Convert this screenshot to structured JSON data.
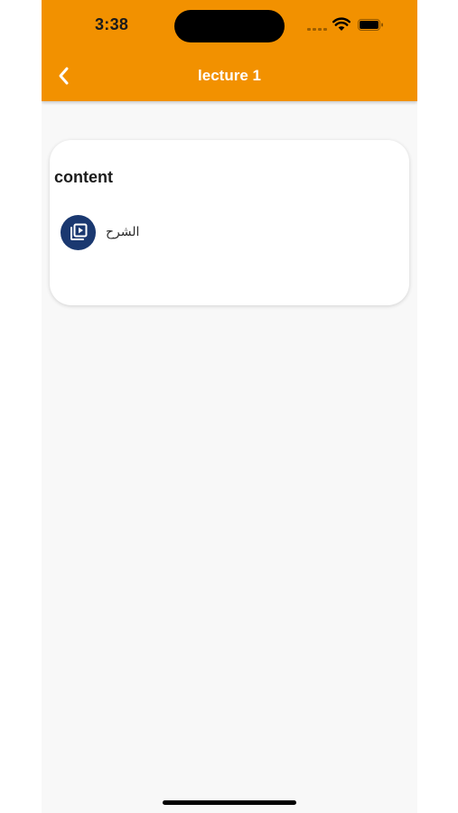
{
  "status_bar": {
    "time": "3:38"
  },
  "header": {
    "title": "lecture 1",
    "back_icon": "chevron-left-icon",
    "background_color": "#f29100"
  },
  "content_card": {
    "title": "content",
    "items": [
      {
        "label": "الشرح",
        "icon": "video-library-icon",
        "icon_background": "#1a3870"
      }
    ]
  }
}
